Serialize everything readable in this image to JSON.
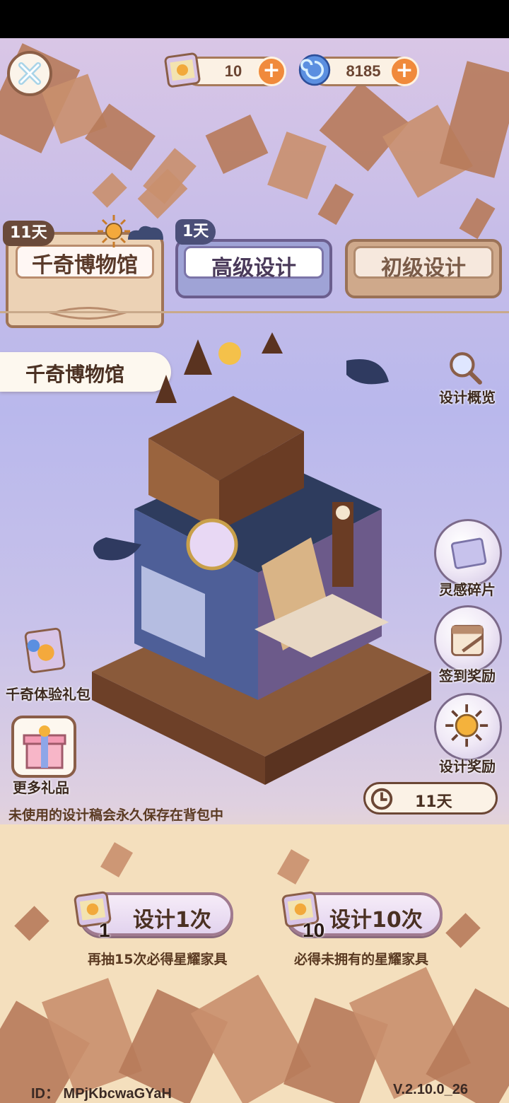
{
  "currency": {
    "tickets": "10",
    "gems": "8185"
  },
  "tabs": {
    "museum": {
      "label": "千奇博物馆",
      "days": "11天"
    },
    "advanced": {
      "label": "高级设计",
      "days": "1天"
    },
    "basic": {
      "label": "初级设计"
    }
  },
  "pool_title": "千奇博物馆",
  "side_buttons": {
    "overview": "设计概览",
    "fragments": "灵感碎片",
    "checkin": "签到奖励",
    "rewards": "设计奖励"
  },
  "left_buttons": {
    "trial_pack": "千奇体验礼包",
    "more_gifts": "更多礼品"
  },
  "notice": "未使用的设计稿会永久保存在背包中",
  "timer": "11天",
  "draw": {
    "single": {
      "label": "设计1次",
      "count": "1",
      "sub": "再抽15次必得星耀家具"
    },
    "ten": {
      "label": "设计10次",
      "count": "10",
      "sub": "必得未拥有的星耀家具"
    }
  },
  "footer": {
    "id": "ID：  MPjKbcwaGYaH",
    "version": "V.2.10.0_26"
  },
  "colors": {
    "accent": "#f08a3c",
    "brown": "#a07456",
    "lavender": "#9fa3d6"
  }
}
